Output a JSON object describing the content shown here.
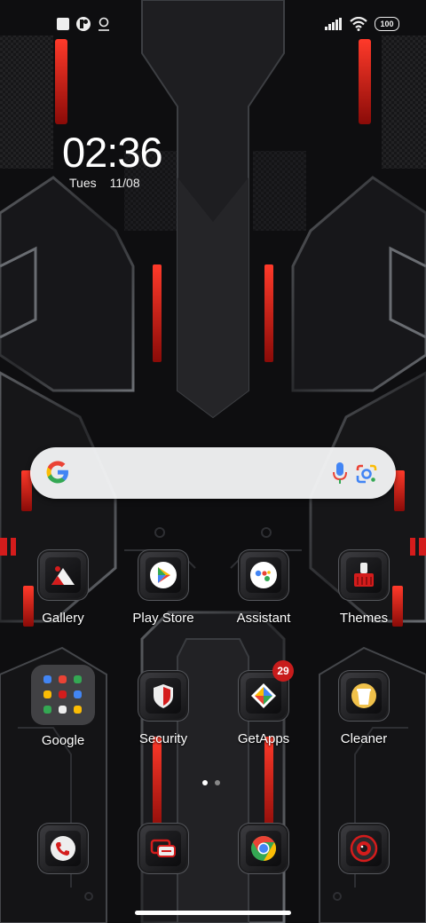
{
  "status_bar": {
    "left_icons": [
      "square-icon",
      "app-notification-icon",
      "location-icon"
    ],
    "battery_level": "100",
    "right_icons": [
      "signal-icon",
      "wifi-icon",
      "battery-icon"
    ]
  },
  "clock": {
    "time": "02:36",
    "day": "Tues",
    "date": "11/08"
  },
  "search_bar": {
    "icons": [
      "google-g-icon",
      "microphone-icon",
      "google-lens-icon"
    ]
  },
  "apps_row1": [
    {
      "label": "Gallery",
      "icon": "gallery-icon"
    },
    {
      "label": "Play Store",
      "icon": "play-store-icon"
    },
    {
      "label": "Assistant",
      "icon": "assistant-icon"
    },
    {
      "label": "Themes",
      "icon": "themes-icon"
    }
  ],
  "apps_row2": [
    {
      "label": "Google",
      "icon": "google-folder-icon"
    },
    {
      "label": "Security",
      "icon": "security-icon"
    },
    {
      "label": "GetApps",
      "icon": "getapps-icon",
      "badge": "29"
    },
    {
      "label": "Cleaner",
      "icon": "cleaner-icon"
    }
  ],
  "dock": [
    {
      "icon": "phone-icon"
    },
    {
      "icon": "messages-icon"
    },
    {
      "icon": "chrome-icon"
    },
    {
      "icon": "camera-icon"
    }
  ],
  "page_indicator": {
    "pages": 2,
    "current": 1
  },
  "colors": {
    "accent_red": "#d41c1c",
    "wallpaper_dark": "#0b0b0d",
    "metal": "#8a8d92"
  }
}
